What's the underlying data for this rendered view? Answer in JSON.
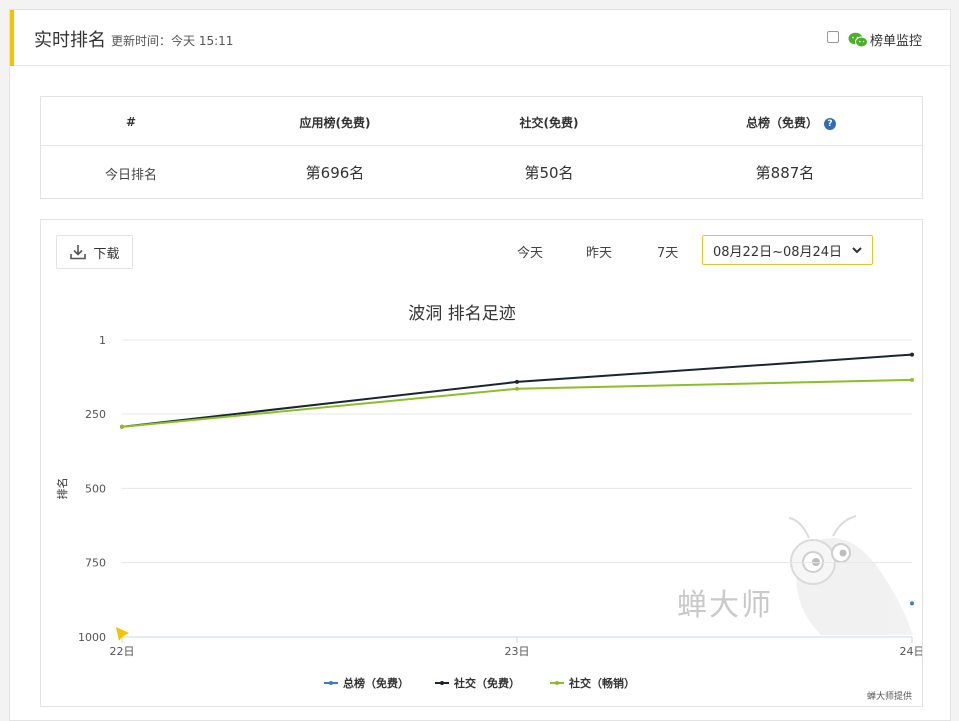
{
  "header": {
    "title": "实时排名",
    "update_time": "更新时间：今天 15:11",
    "monitor_label": "榜单监控",
    "monitor_checked": false
  },
  "rank_table": {
    "headers": [
      "#",
      "应用榜(免费)",
      "社交(免费)",
      "总榜（免费）"
    ],
    "row": {
      "label": "今日排名",
      "values": [
        "第696名",
        "第50名",
        "第887名"
      ]
    }
  },
  "toolbar": {
    "download_label": "下载",
    "tabs": [
      "今天",
      "昨天",
      "7天"
    ],
    "date_range": "08月22日~08月24日"
  },
  "watermark": "蝉大师",
  "credit": "蝉大师提供",
  "chart_data": {
    "type": "line",
    "title": "波洞 排名足迹",
    "ylabel": "排名",
    "x": [
      "22日",
      "23日",
      "24日"
    ],
    "ylim": [
      1000,
      1
    ],
    "y_reversed": true,
    "y_ticks": [
      1,
      250,
      500,
      750,
      1000
    ],
    "y_tick_labels": [
      "1",
      "250",
      "500",
      "750",
      "1000"
    ],
    "legend_position": "bottom",
    "series": [
      {
        "name": "总榜（免费）",
        "color": "#3a7cc4",
        "values": [
          null,
          null,
          887
        ]
      },
      {
        "name": "社交（免费）",
        "color": "#1a2533",
        "values": [
          293,
          142,
          50
        ]
      },
      {
        "name": "社交（畅销）",
        "color": "#8cbf26",
        "values": [
          293,
          165,
          135
        ]
      }
    ]
  }
}
